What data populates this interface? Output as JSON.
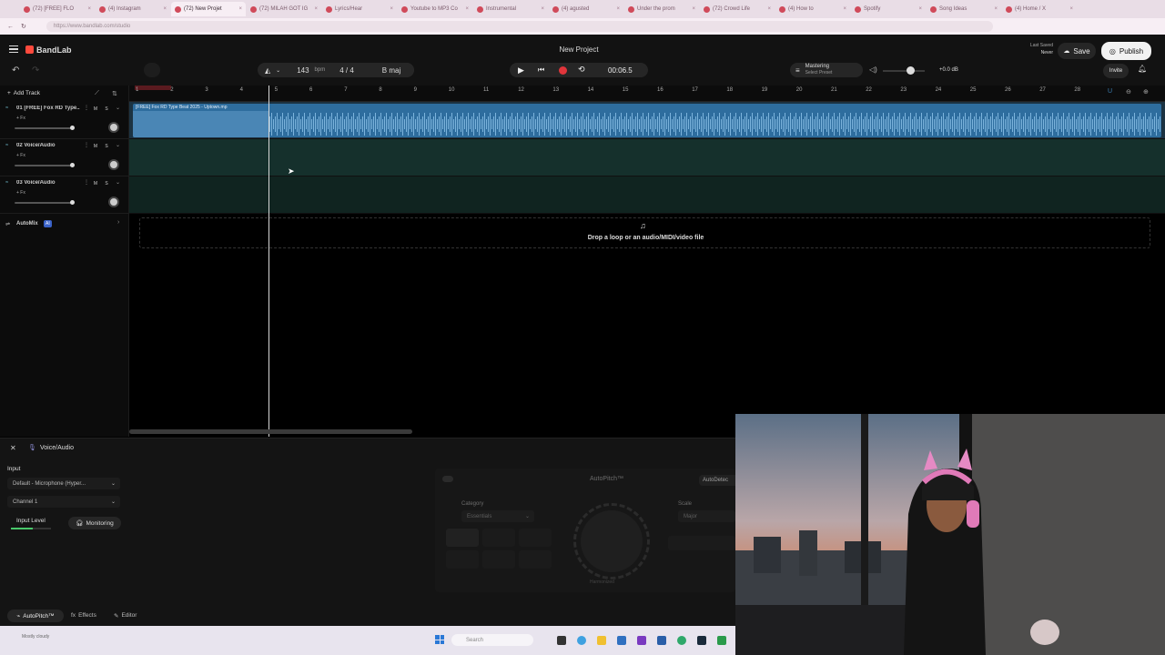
{
  "browser": {
    "tabs": [
      {
        "label": "(72) [FREE] FLO",
        "active": false
      },
      {
        "label": "(4) Instagram",
        "active": false
      },
      {
        "label": "(72) New Projet",
        "active": true
      },
      {
        "label": "(72) MILAH GOT IG",
        "active": false
      },
      {
        "label": "Lyrics/Hear",
        "active": false
      },
      {
        "label": "Youtube to MP3 Co",
        "active": false
      },
      {
        "label": "Instrumental",
        "active": false
      },
      {
        "label": "(4) agusted",
        "active": false
      },
      {
        "label": "Under the prom",
        "active": false
      },
      {
        "label": "(72) Crowd Life",
        "active": false
      },
      {
        "label": "(4) How to",
        "active": false
      },
      {
        "label": "Spotify",
        "active": false
      },
      {
        "label": "Song Ideas",
        "active": false
      },
      {
        "label": "(4) Home / X",
        "active": false
      }
    ],
    "url": "https://www.bandlab.com/studio"
  },
  "app": {
    "brand": "BandLab",
    "project_title": "New Project",
    "last_saved_label": "Last Saved",
    "last_saved_value": "Never",
    "save_label": "Save",
    "publish_label": "Publish",
    "invite_label": "Invite",
    "bpm_value": "143",
    "bpm_unit": "bpm",
    "time_signature": "4 / 4",
    "key": "B maj",
    "time": "00:06.5",
    "mastering_label": "Mastering",
    "mastering_sub": "Select Preset",
    "volume_db": "+0.0 dB"
  },
  "timeline": {
    "add_track_label": "Add Track",
    "ruler_ticks": [
      "1",
      "2",
      "3",
      "4",
      "5",
      "6",
      "7",
      "8",
      "9",
      "10",
      "11",
      "12",
      "13",
      "14",
      "15",
      "16",
      "17",
      "18",
      "19",
      "20",
      "21",
      "22",
      "23",
      "24",
      "25",
      "26",
      "27",
      "28"
    ],
    "tracks": [
      {
        "title": "01  [FREE] Fox RD Type...",
        "fx": "+ Fx",
        "clip": "[FREE] Fox RD Type Beat 2025 - Uptown.mp"
      },
      {
        "title": "02  Voice/Audio",
        "fx": "+ Fx"
      },
      {
        "title": "03  Voice/Audio",
        "fx": "+ Fx"
      }
    ],
    "m_label": "M",
    "s_label": "S",
    "automix_label": "AutoMix",
    "automix_badge": "AI",
    "drop_text": "Drop a loop or an audio/MIDI/video file"
  },
  "bottom_panel": {
    "track_name": "Voice/Audio",
    "input_label": "Input",
    "input_device": "Default - Microphone (Hyper...",
    "channel": "Channel 1",
    "input_level_label": "Input Level",
    "monitoring_label": "Monitoring",
    "autopitch_title": "AutoPitch™",
    "autodetect_label": "AutoDetec",
    "category_label": "Category",
    "category_value": "Essentials",
    "scale_label": "Scale",
    "scale_value": "Major",
    "knob_label": "Harmonized",
    "tabs": {
      "autopitch": "AutoPitch™",
      "effects": "Effects",
      "editor": "Editor"
    }
  },
  "taskbar": {
    "search_placeholder": "Search",
    "weather": "Mostly cloudy"
  },
  "colors": {
    "clip_blue": "#3d7fb3",
    "lane_teal": "#1e3a36",
    "record_red": "#e0353b",
    "brand_red": "#ff4a3d"
  }
}
